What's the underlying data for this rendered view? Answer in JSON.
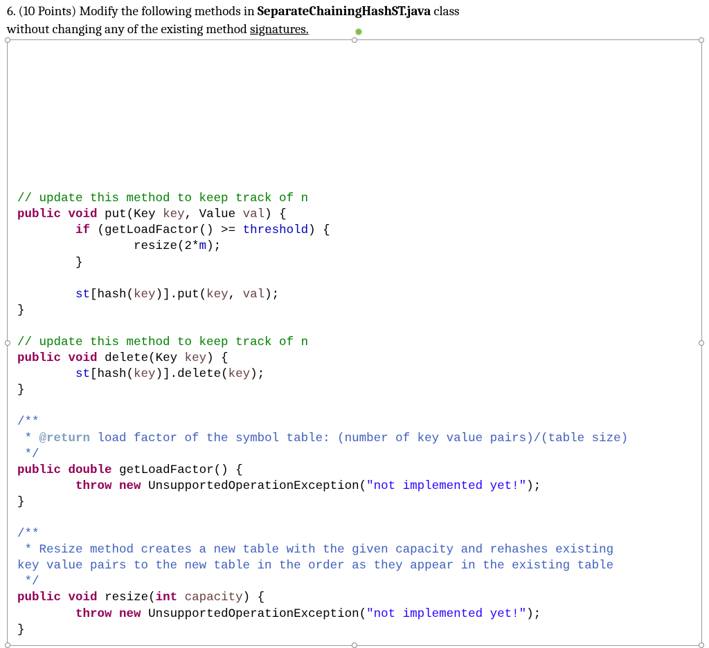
{
  "header": {
    "num": "6.",
    "points": "(10 Points)",
    "part1": "Modify the following methods in ",
    "class_name": "SeparateChainingHashST.java",
    "part2": " class",
    "line2a": "without changing any of the existing method ",
    "line2b": "signatures."
  },
  "code": {
    "l1": "// update this method to keep track of n",
    "l2": {
      "kw1": "public",
      "kw2": "void",
      "name": "put(Key ",
      "p1": "key",
      "mid": ", Value ",
      "p2": "val",
      "end": ") {"
    },
    "l3": {
      "kw": "if",
      "txt1": " (getLoadFactor() >= ",
      "f": "threshold",
      "txt2": ") {"
    },
    "l4": "                resize(2*",
    "l4f": "m",
    "l4e": ");",
    "l5": "        }",
    "l6": "",
    "l7a": "        ",
    "l7f": "st",
    "l7b": "[hash(",
    "l7p": "key",
    "l7c": ")].put(",
    "l7p2": "key",
    "l7d": ", ",
    "l7p3": "val",
    "l7e": ");",
    "l8": "}",
    "l9": "",
    "l10": "// update this method to keep track of n",
    "l11": {
      "kw1": "public",
      "kw2": "void",
      "name": "delete(Key ",
      "p1": "key",
      "end": ") {"
    },
    "l12a": "        ",
    "l12f": "st",
    "l12b": "[hash(",
    "l12p": "key",
    "l12c": ")].delete(",
    "l12p2": "key",
    "l12d": ");",
    "l13": "}",
    "l14": "",
    "l15": "/**",
    "l16a": " * ",
    "l16tag": "@return",
    "l16b": " load factor of the symbol table: (number of key value pairs)/(table size)",
    "l17": " */",
    "l18": {
      "kw1": "public",
      "kw2": "double",
      "name": "getLoadFactor() {"
    },
    "l19a": "        ",
    "l19kw1": "throw",
    "l19kw2": "new",
    "l19b": " UnsupportedOperationException(",
    "l19s": "\"not implemented yet!\"",
    "l19c": ");",
    "l20": "}",
    "l21": "",
    "l22": "/**",
    "l23": " * Resize method creates a new table with the given capacity and rehashes existing",
    "l24": "key value pairs to the new table in the order as they appear in the existing table",
    "l25": " */",
    "l26": {
      "kw1": "public",
      "kw2": "void",
      "name": "resize(",
      "kw3": "int",
      "p1": "capacity",
      "end": ") {"
    },
    "l27a": "        ",
    "l27kw1": "throw",
    "l27kw2": "new",
    "l27b": " UnsupportedOperationException(",
    "l27s": "\"not implemented yet!\"",
    "l27c": ");",
    "l28": "}"
  }
}
